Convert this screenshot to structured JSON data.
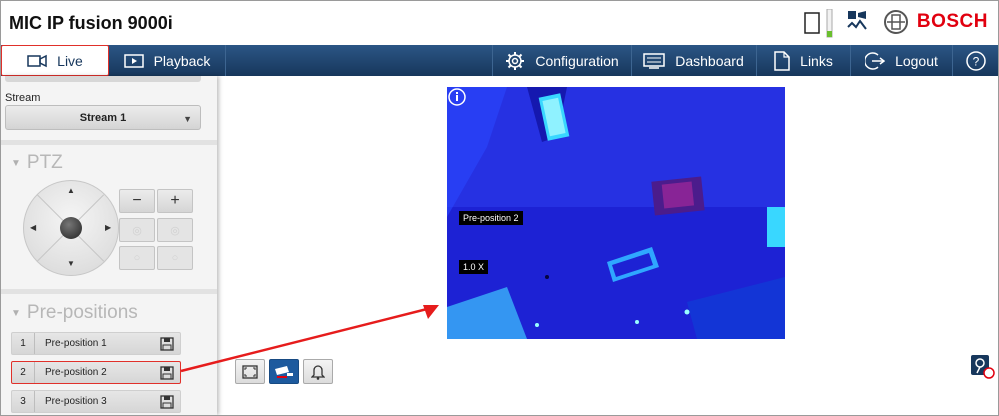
{
  "header": {
    "app_title": "MIC IP fusion 9000i",
    "brand": "BOSCH"
  },
  "nav": {
    "live": "Live",
    "playback": "Playback",
    "configuration": "Configuration",
    "dashboard": "Dashboard",
    "links": "Links",
    "logout": "Logout"
  },
  "sidebar": {
    "stream_label": "Stream",
    "stream_value": "Stream 1",
    "ptz_title": "PTZ",
    "ptz_zoom_out": "−",
    "ptz_zoom_in": "+",
    "presets_title": "Pre-positions",
    "presets": [
      {
        "num": "1",
        "name": "Pre-position 1"
      },
      {
        "num": "2",
        "name": "Pre-position 2"
      },
      {
        "num": "3",
        "name": "Pre-position 3"
      }
    ]
  },
  "video": {
    "osd_preset": "Pre-position 2",
    "osd_zoom": "1.0  X"
  },
  "colors": {
    "accent": "#17375c",
    "brand": "#e1000f",
    "highlight": "#e0302a"
  }
}
